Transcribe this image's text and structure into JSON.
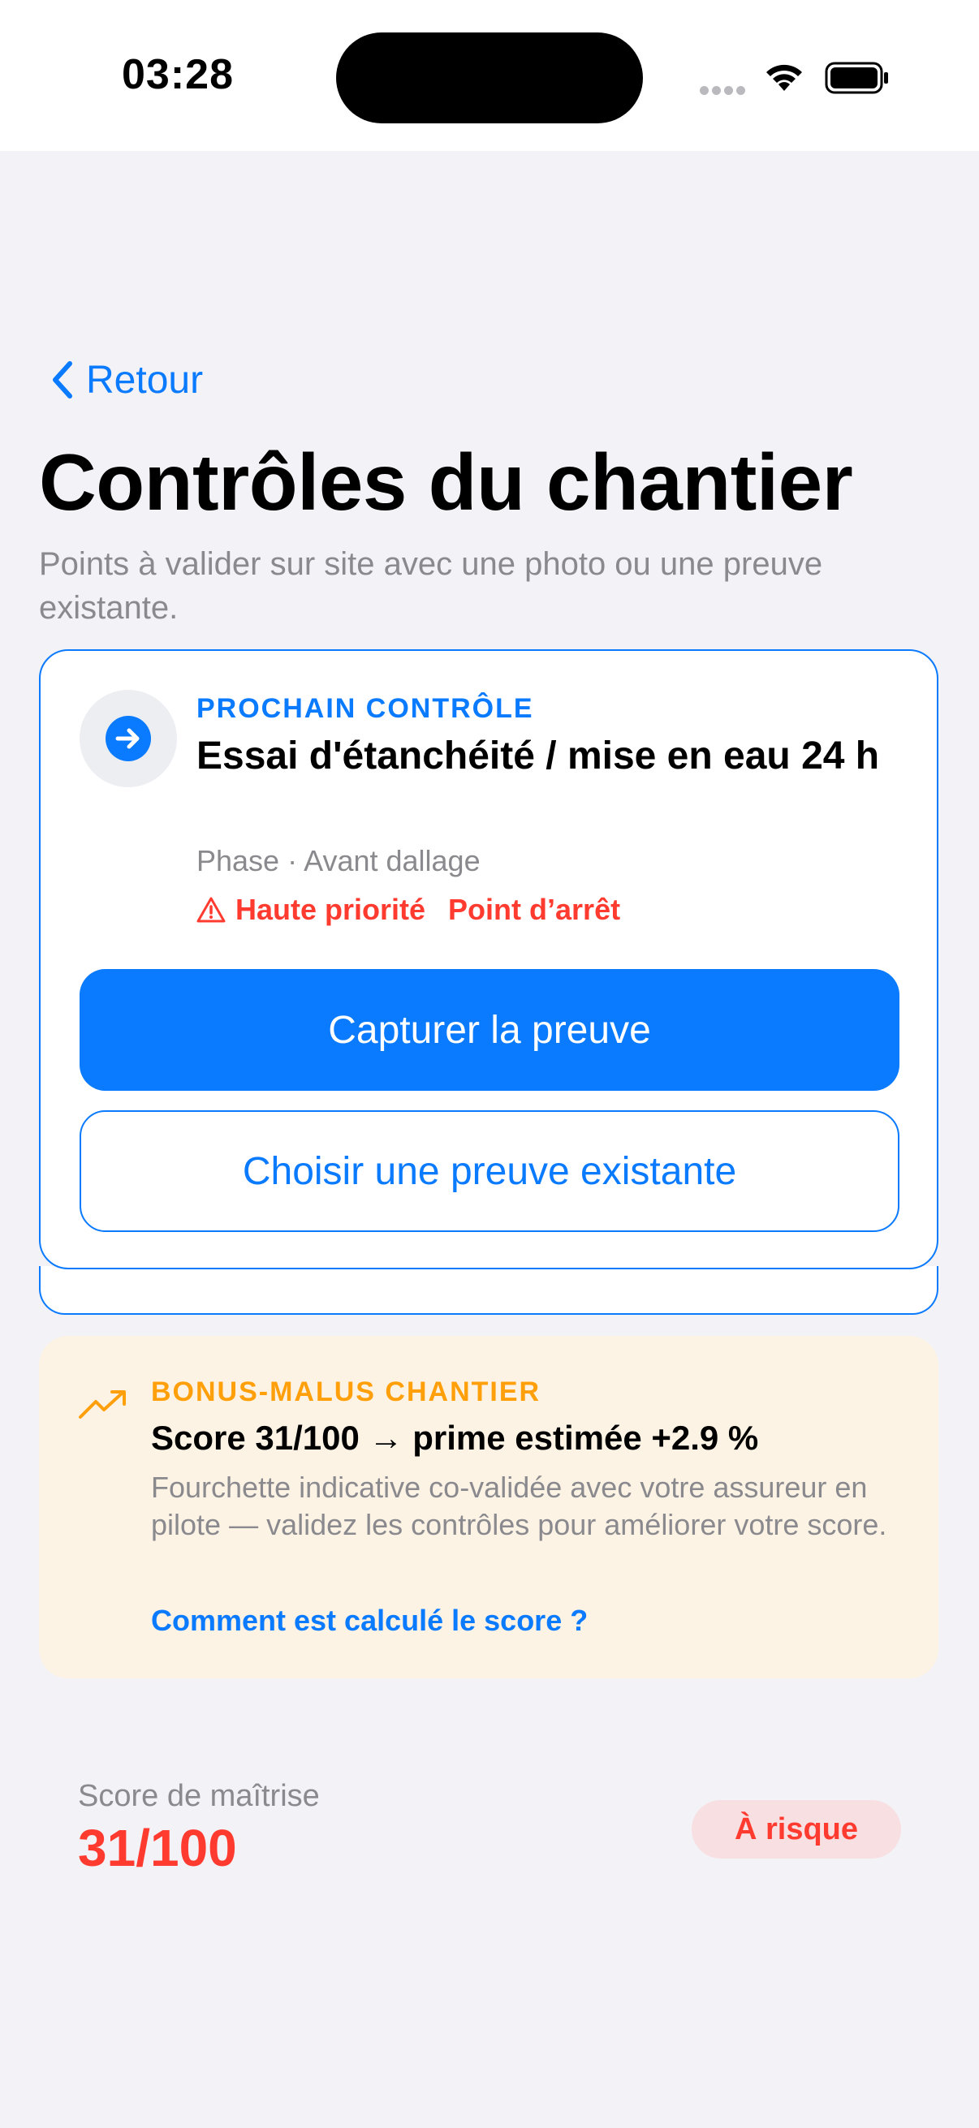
{
  "status_bar": {
    "time": "03:28"
  },
  "nav": {
    "back_label": "Retour",
    "back_icon": "chevron-left-icon"
  },
  "page": {
    "title": "Contrôles du chantier",
    "subtitle": "Points à valider sur site avec une photo ou une preuve existante."
  },
  "next_check": {
    "icon": "arrow-right-circle-icon",
    "eyebrow": "PROCHAIN CONTRÔLE",
    "title": "Essai d'étanchéité / mise en eau 24 h",
    "phase": "Phase · Avant dallage",
    "priority_icon": "warning-triangle-icon",
    "priority": "Haute priorité",
    "hold_point": "Point d’arrêt",
    "primary_button": "Capturer la preuve",
    "secondary_button": "Choisir une preuve existante"
  },
  "bonus_malus": {
    "icon": "trending-up-icon",
    "eyebrow": "BONUS-MALUS CHANTIER",
    "title": "Score 31/100 → prime estimée +2.9 %",
    "description": "Fourchette indicative co-validée avec votre assureur en pilote — validez les contrôles pour améliorer votre score.",
    "link": "Comment est calculé le score ?"
  },
  "mastery": {
    "label": "Score de maîtrise",
    "value": "31/100",
    "badge": "À risque"
  },
  "colors": {
    "accent": "#0a7aff",
    "danger": "#ff3b30",
    "warning": "#ff9f0a",
    "background": "#f2f2f7"
  }
}
